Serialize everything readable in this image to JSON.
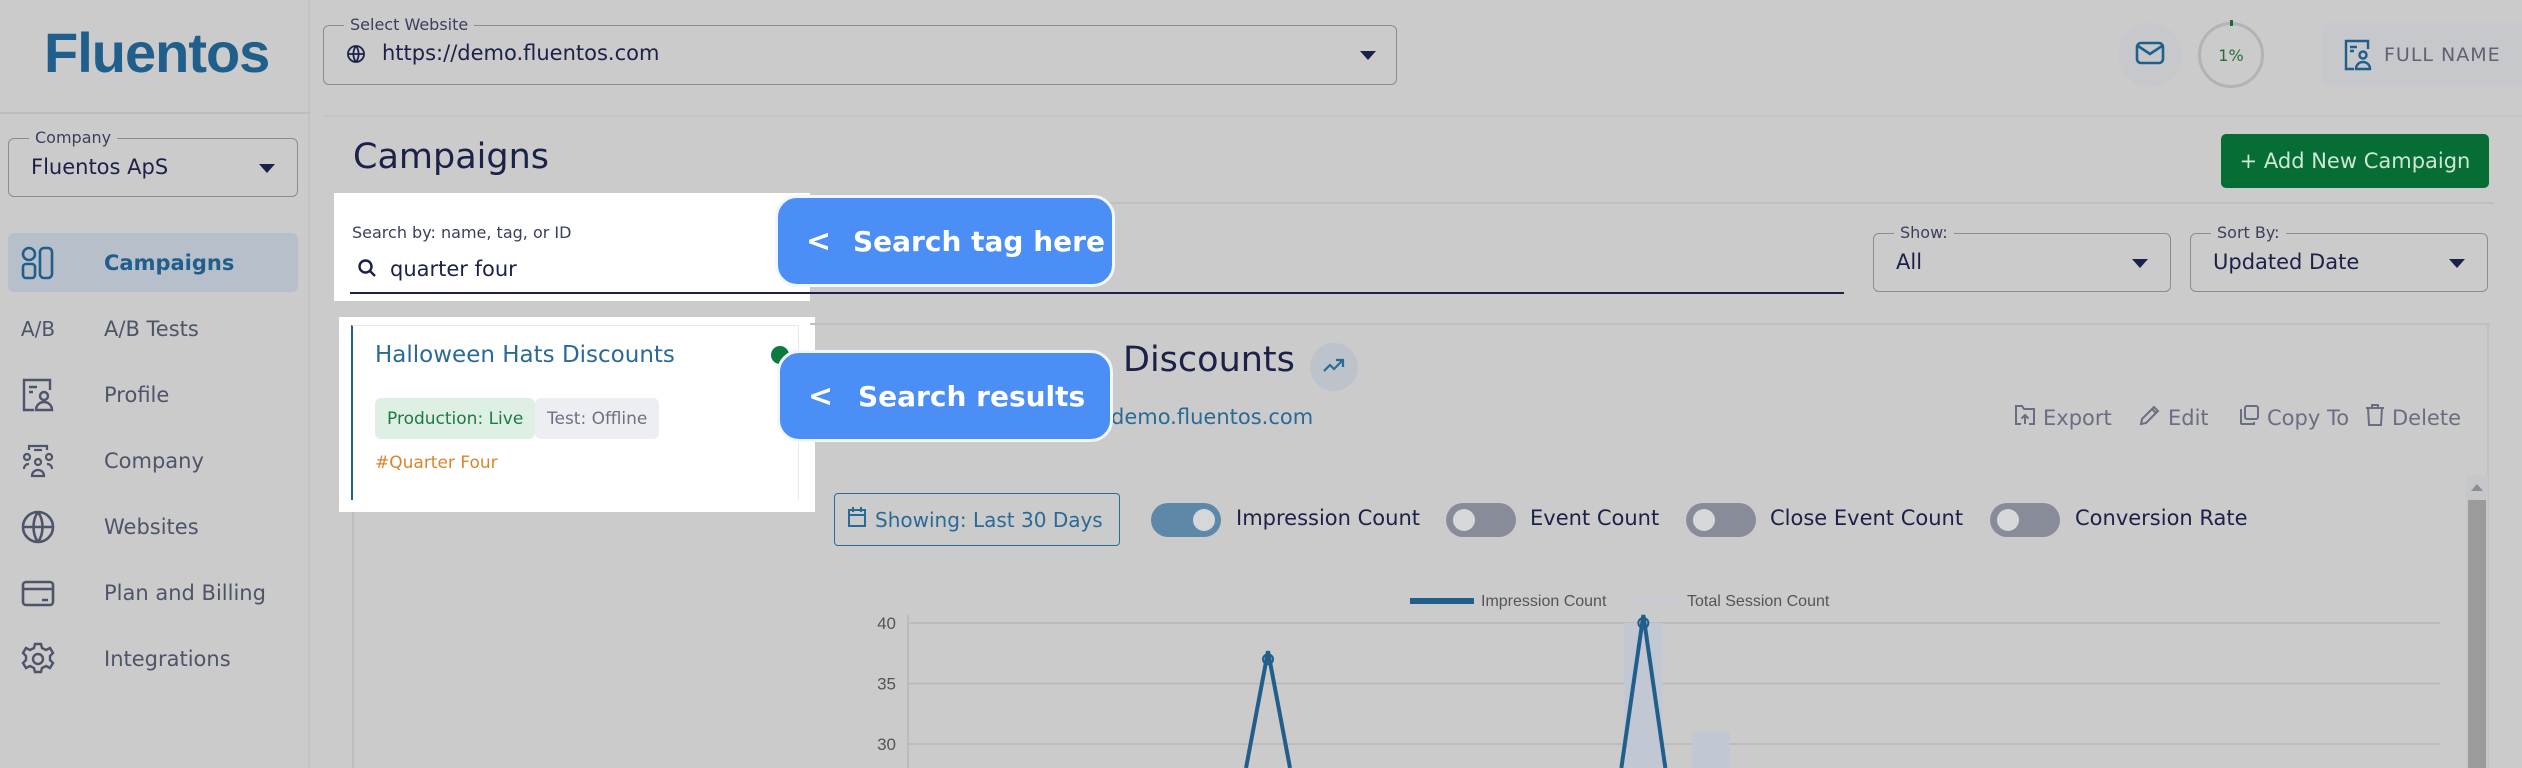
{
  "app": {
    "logo": "Fluentos"
  },
  "sidebar": {
    "company_label": "Company",
    "company_value": "Fluentos ApS",
    "items": [
      {
        "label": "Campaigns",
        "icon": "campaigns-icon",
        "active": true
      },
      {
        "label": "A/B Tests",
        "icon": "ab-tests-icon",
        "icon_text": "A/B",
        "active": false
      },
      {
        "label": "Profile",
        "icon": "profile-icon",
        "active": false
      },
      {
        "label": "Company",
        "icon": "company-icon",
        "active": false
      },
      {
        "label": "Websites",
        "icon": "globe-icon",
        "active": false
      },
      {
        "label": "Plan and Billing",
        "icon": "credit-card-icon",
        "active": false
      },
      {
        "label": "Integrations",
        "icon": "gear-icon",
        "active": false
      }
    ]
  },
  "topbar": {
    "website_label": "Select Website",
    "website_value": "https://demo.fluentos.com",
    "progress_text": "1%",
    "progress_percent": 1,
    "user_name": "FULL NAME"
  },
  "main": {
    "title": "Campaigns",
    "add_button": "+ Add New Campaign",
    "search": {
      "label": "Search by: name, tag, or ID",
      "value": "quarter four"
    },
    "show": {
      "label": "Show:",
      "value": "All"
    },
    "sort": {
      "label": "Sort By:",
      "value": "Updated Date"
    },
    "results": [
      {
        "title": "Halloween Hats Discounts",
        "production_badge": "Production: Live",
        "test_badge": "Test: Offline",
        "tag": "#Quarter Four",
        "status_color": "#0b7a3c"
      }
    ]
  },
  "detail": {
    "title_visible": "Discounts",
    "url_visible": "demo.fluentos.com",
    "actions": {
      "export": "Export",
      "edit": "Edit",
      "copy": "Copy To",
      "delete": "Delete"
    },
    "date_range": "Showing: Last 30 Days",
    "toggles": [
      {
        "label": "Impression Count",
        "on": true
      },
      {
        "label": "Event Count",
        "on": false
      },
      {
        "label": "Close Event Count",
        "on": false
      },
      {
        "label": "Conversion Rate",
        "on": false
      }
    ]
  },
  "tooltips": {
    "search": {
      "chevron": "<",
      "text": "Search tag here"
    },
    "results": {
      "chevron": "<",
      "text": "Search results"
    }
  },
  "colors": {
    "brand": "#205e8c",
    "add_button": "#066d35",
    "tooltip": "#4a8ef6",
    "tag": "#d9852c",
    "live": "#1d7a45"
  },
  "chart_data": {
    "type": "line",
    "title": "",
    "legend": [
      "Impression Count",
      "Total Session Count"
    ],
    "legend_position": "top",
    "y_ticks": [
      40,
      35,
      30
    ],
    "ylim_visible": [
      28,
      40
    ],
    "grid": true,
    "series": [
      {
        "name": "Impression Count",
        "type": "line",
        "points": [
          {
            "x_frac": 0.235,
            "y": 37
          },
          {
            "x_frac": 0.48,
            "y": 40
          }
        ]
      },
      {
        "name": "Total Session Count",
        "type": "bar",
        "points": [
          {
            "x_frac": 0.48,
            "y": 40
          },
          {
            "x_frac": 0.524,
            "y": 31
          }
        ]
      }
    ]
  }
}
